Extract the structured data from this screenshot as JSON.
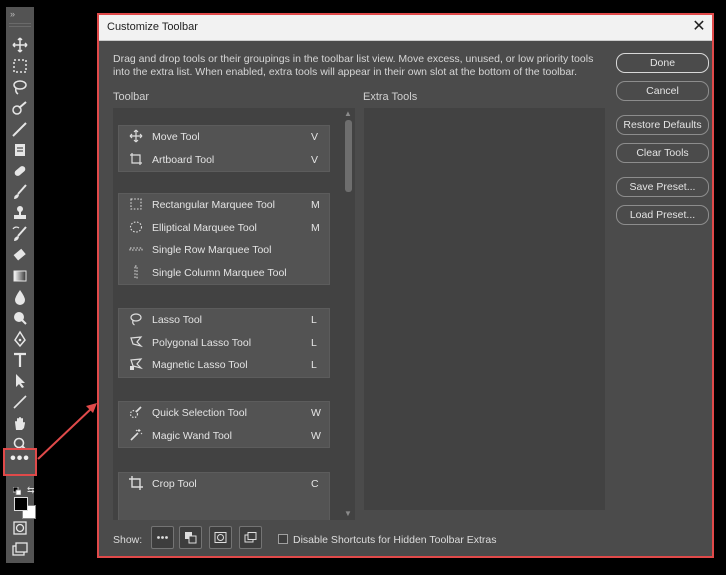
{
  "dialog": {
    "title": "Customize Toolbar",
    "close_glyph": "✕",
    "intro": "Drag and drop tools or their groupings in the toolbar list view. Move excess, unused, or low priority tools into the extra list. When enabled, extra tools will appear in their own slot at the bottom of the toolbar.",
    "toolbar_label": "Toolbar",
    "extra_label": "Extra Tools"
  },
  "buttons": {
    "done": "Done",
    "cancel": "Cancel",
    "restore": "Restore Defaults",
    "clear": "Clear Tools",
    "save": "Save Preset...",
    "load": "Load Preset..."
  },
  "groups": [
    {
      "tools": [
        {
          "name": "Move Tool",
          "key": "V",
          "icon": "move-icon"
        },
        {
          "name": "Artboard Tool",
          "key": "V",
          "icon": "artboard-icon"
        }
      ]
    },
    {
      "tools": [
        {
          "name": "Rectangular Marquee Tool",
          "key": "M",
          "icon": "rect-marquee-icon"
        },
        {
          "name": "Elliptical Marquee Tool",
          "key": "M",
          "icon": "ellipse-marquee-icon"
        },
        {
          "name": "Single Row Marquee Tool",
          "key": "",
          "icon": "row-marquee-icon"
        },
        {
          "name": "Single Column Marquee Tool",
          "key": "",
          "icon": "column-marquee-icon"
        }
      ]
    },
    {
      "tools": [
        {
          "name": "Lasso Tool",
          "key": "L",
          "icon": "lasso-icon"
        },
        {
          "name": "Polygonal Lasso Tool",
          "key": "L",
          "icon": "polygonal-lasso-icon"
        },
        {
          "name": "Magnetic Lasso Tool",
          "key": "L",
          "icon": "magnetic-lasso-icon"
        }
      ]
    },
    {
      "tools": [
        {
          "name": "Quick Selection Tool",
          "key": "W",
          "icon": "quick-selection-icon"
        },
        {
          "name": "Magic Wand Tool",
          "key": "W",
          "icon": "magic-wand-icon"
        }
      ]
    },
    {
      "tools": [
        {
          "name": "Crop Tool",
          "key": "C",
          "icon": "crop-icon"
        }
      ]
    }
  ],
  "footer": {
    "show_label": "Show:",
    "shortcut_label": "Disable Shortcuts for Hidden Toolbar Extras"
  },
  "toolbar_more_glyph": "•••",
  "colors": {
    "accent_red": "#e04a4a",
    "dialog_bg": "#4b4b4b",
    "panel_bg": "#424242"
  }
}
